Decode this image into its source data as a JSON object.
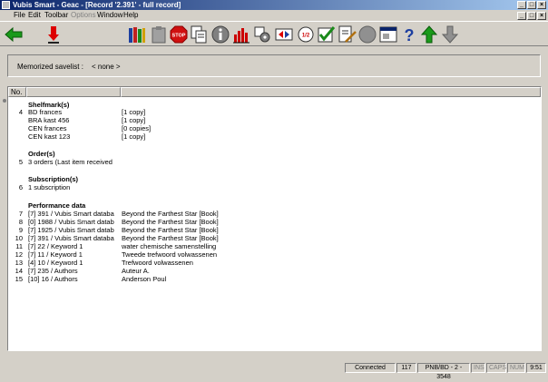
{
  "window": {
    "title": "Vubis Smart - Geac - [Record '2.391' - full record]",
    "min": "_",
    "max": "□",
    "close": "×"
  },
  "menu": [
    {
      "label": "File"
    },
    {
      "label": "Edit"
    },
    {
      "label": "Toolbar"
    },
    {
      "label": "Options"
    },
    {
      "label": "Window"
    },
    {
      "label": "Help"
    }
  ],
  "toolbar_icons": [
    "back-arrow",
    "download",
    "books",
    "clipboard",
    "stop",
    "copy",
    "info",
    "bar-chart",
    "settings",
    "transfer",
    "exchange",
    "checkbox",
    "edit",
    "circle",
    "window",
    "help",
    "up-arrow",
    "down-arrow"
  ],
  "saved": {
    "label": "Memorized savelist :",
    "value": "< none >"
  },
  "list": {
    "header": {
      "no": "No."
    },
    "sections": [
      {
        "title": "Shelfmark(s)",
        "rows": [
          {
            "no": "4",
            "a": "BD frances",
            "b": "[1 copy]"
          },
          {
            "no": "",
            "a": "BRA kast 456",
            "b": "[1 copy]"
          },
          {
            "no": "",
            "a": "CEN frances",
            "b": "[0 copies]"
          },
          {
            "no": "",
            "a": "CEN kast 123",
            "b": "[1 copy]"
          }
        ]
      },
      {
        "title": "Order(s)",
        "rows": [
          {
            "no": "5",
            "a": "3 orders (Last item received",
            "b": ""
          }
        ]
      },
      {
        "title": "Subscription(s)",
        "rows": [
          {
            "no": "6",
            "a": "1 subscription",
            "b": ""
          }
        ]
      },
      {
        "title": "Performance data",
        "rows": [
          {
            "no": "7",
            "a": "[7] 391 / Vubis Smart databa",
            "b": "Beyond the Farthest Star  [Book]"
          },
          {
            "no": "8",
            "a": "[0] 1988 / Vubis Smart datab",
            "b": "Beyond the Farthest Star  [Book]"
          },
          {
            "no": "9",
            "a": "[7] 1925 / Vubis Smart datab",
            "b": "Beyond the Farthest Star  [Book]"
          },
          {
            "no": "10",
            "a": "[7] 391 / Vubis Smart databa",
            "b": "Beyond the Farthest Star  [Book]"
          },
          {
            "no": "11",
            "a": "[7] 22 / Keyword 1",
            "b": "water chemische samenstelling"
          },
          {
            "no": "12",
            "a": "[7] 11 / Keyword 1",
            "b": "Tweede trefwoord volwassenen"
          },
          {
            "no": "13",
            "a": "[4] 10 / Keyword 1",
            "b": "Trefwoord volwassenen"
          },
          {
            "no": "14",
            "a": "[7] 235 / Authors",
            "b": "Auteur A."
          },
          {
            "no": "15",
            "a": "[10] 16 / Authors",
            "b": "Anderson Poul"
          }
        ]
      }
    ]
  },
  "status": {
    "connected": "Connected",
    "count": "117",
    "db": "PNB/BD - 2 - 3548",
    "ins": "INS",
    "caps": "CAPS",
    "num": "NUM",
    "time": "9:51"
  }
}
